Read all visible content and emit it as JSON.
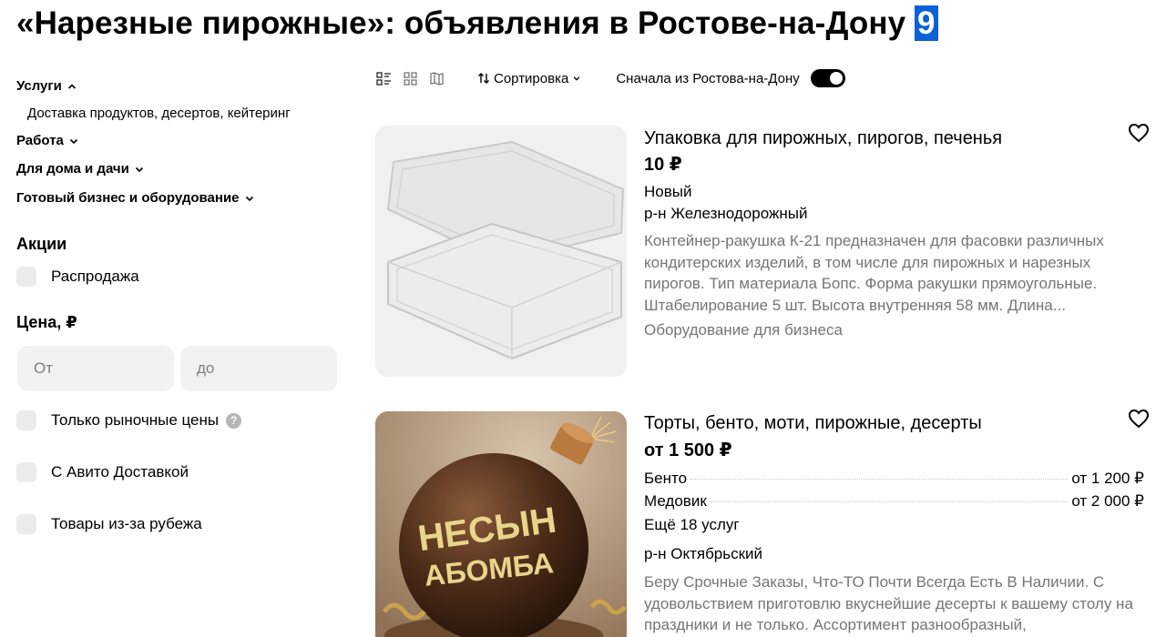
{
  "header": {
    "title": "«Нарезные пирожные»: объявления в Ростове-на-Дону",
    "count": "9"
  },
  "sidebar": {
    "categories": [
      {
        "label": "Услуги",
        "expanded": true
      },
      {
        "label": "Работа",
        "expanded": false
      },
      {
        "label": "Для дома и дачи",
        "expanded": false
      },
      {
        "label": "Готовый бизнес и оборудование",
        "expanded": false
      }
    ],
    "subcategory": "Доставка продуктов, десертов, кейтеринг",
    "promo_title": "Акции",
    "sale_label": "Распродажа",
    "price_title": "Цена, ₽",
    "price_from_placeholder": "От",
    "price_to_placeholder": "до",
    "market_prices_label": "Только рыночные цены",
    "avito_delivery_label": "С Авито Доставкой",
    "abroad_label": "Товары из-за рубежа"
  },
  "toolbar": {
    "view_icons": [
      "list-view-icon",
      "grid-view-icon",
      "map-view-icon"
    ],
    "sort_label": "Сортировка",
    "rostov_first_label": "Сначала из Ростова-на-Дону",
    "rostov_first_enabled": true
  },
  "listings": [
    {
      "title": "Упаковка для пирожных, пирогов, печенья",
      "price": "10 ₽",
      "condition": "Новый",
      "district": "р-н Железнодорожный",
      "description": "Контейнер-ракушка К-21 предназначен для фасовки различных кондитерских изделий, в том числе для пирожных и нарезных пирогов. Тип материала Бопс. Форма ракушки прямоугольные. Штабелирование 5 шт. Высота внутренняя 58 мм. Длина...",
      "category": "Оборудование для бизнеса"
    },
    {
      "title": "Торты, бенто, моти, пирожные, десерты",
      "price": "от 1 500 ₽",
      "services": [
        {
          "name": "Бенто",
          "price": "от 1 200 ₽"
        },
        {
          "name": "Медовик",
          "price": "от 2 000 ₽"
        }
      ],
      "more_services": "Ещё 18 услуг",
      "district": "р-н Октябрьский",
      "description": "Беру Срочные Заказы, Что-ТО Почти Всегда Есть В Наличии. С удовольствием приготовлю вкуснейшие десерты к вашему столу на праздники и не только. Ассортимент разнообразный,",
      "cake_text_top": "НЕСЫН",
      "cake_text_bottom": "АБОМБА"
    }
  ],
  "colors": {
    "accent": "#0a61d8",
    "muted_text": "#757575",
    "input_bg": "#f2f2f2",
    "checkbox_bg": "#ebebeb"
  }
}
